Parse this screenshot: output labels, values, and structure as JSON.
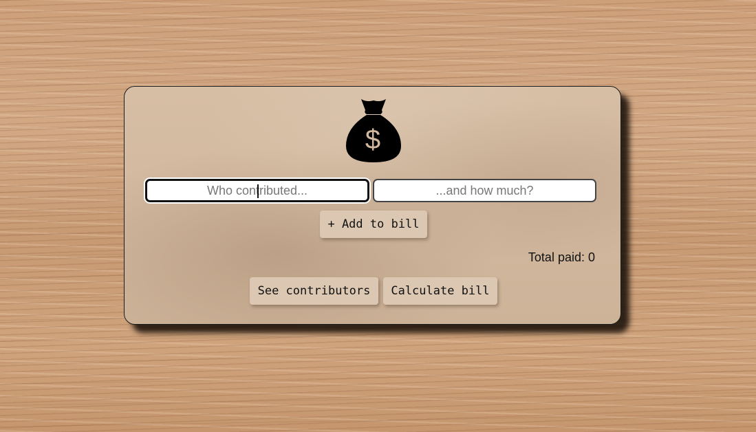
{
  "app": {
    "icon": "money-bag-icon",
    "icon_symbol": "$",
    "icon_colors": {
      "bag": "#000000",
      "symbol": "#d2b89e"
    }
  },
  "form": {
    "name_placeholder": "Who contributed...",
    "amount_placeholder": "...and how much?",
    "add_button_label": "+ Add to bill"
  },
  "summary": {
    "total_label": "Total paid: 0"
  },
  "actions": {
    "see_contributors_label": "See contributors",
    "calculate_label": "Calculate bill"
  }
}
